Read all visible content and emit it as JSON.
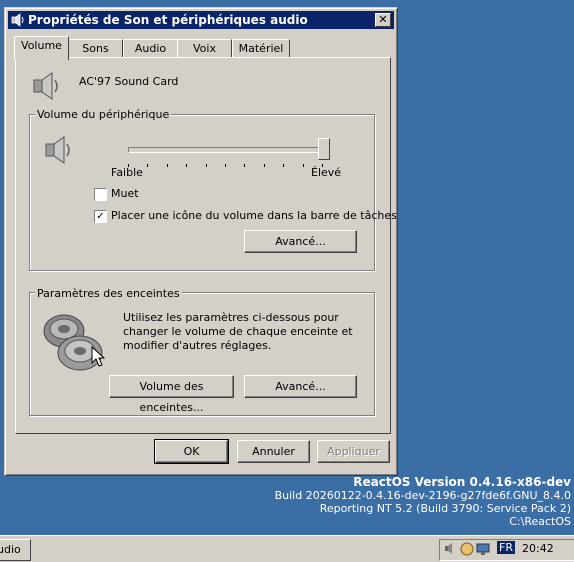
{
  "dialog": {
    "title": "Propriétés de Son et périphériques audio",
    "close_label": "✕"
  },
  "tabs": [
    {
      "label": "Volume",
      "active": true
    },
    {
      "label": "Sons"
    },
    {
      "label": "Audio"
    },
    {
      "label": "Voix"
    },
    {
      "label": "Matériel"
    }
  ],
  "device": {
    "name": "AC'97 Sound Card",
    "icon": "speaker-icon"
  },
  "device_volume": {
    "legend": "Volume du périphérique",
    "level": 1.0,
    "min_label": "Faible",
    "max_label": "Élevé",
    "mute_label": "Muet",
    "mute_checked": false,
    "tray_icon_label": "Placer une icône du volume dans la barre de tâches",
    "tray_icon_checked": true,
    "advanced_label": "Avancé..."
  },
  "speakers": {
    "legend": "Paramètres des enceintes",
    "description": "Utilisez les paramètres ci-dessous pour changer le volume de chaque enceinte et modifier d'autres réglages.",
    "volume_button_label": "Volume des enceintes...",
    "advanced_label": "Avancé..."
  },
  "footer": {
    "ok_label": "OK",
    "cancel_label": "Annuler",
    "apply_label": "Appliquer"
  },
  "desktop": {
    "version": "ReactOS Version 0.4.16-x86-dev",
    "build": "Build 20260122-0.4.16-dev-2196-g27fde6f.GNU_8.4.0",
    "reporting": "Reporting NT 5.2 (Build 3790: Service Pack 2)",
    "path": "C:\\ReactOS"
  },
  "taskbar": {
    "task_label": "udio",
    "language": "FR",
    "clock": "20:42"
  },
  "colors": {
    "desktop": "#3a6ea5",
    "titlebar": "#0a246a",
    "face": "#d4d0c8"
  }
}
